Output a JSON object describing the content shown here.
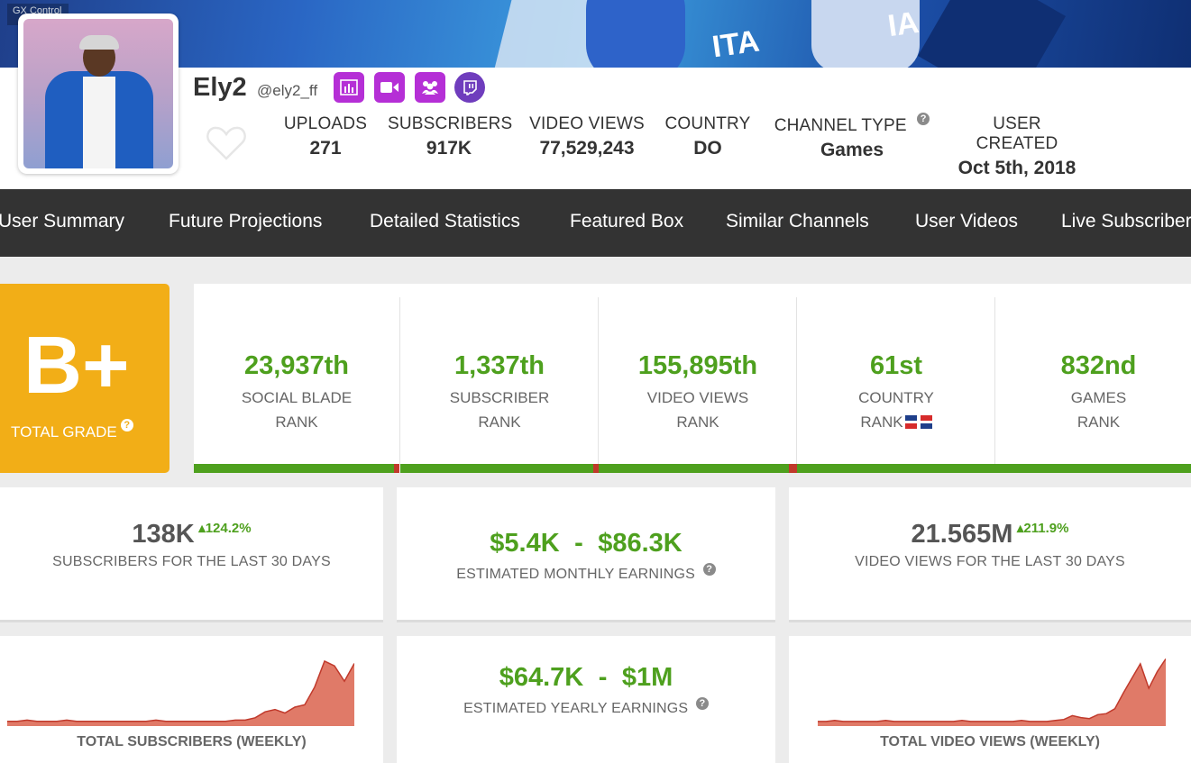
{
  "banner": {
    "control_label": "GX Control",
    "text_left": "ITA",
    "text_right": "IA"
  },
  "profile": {
    "name": "Ely2",
    "handle": "@ely2_ff",
    "icons": [
      "bar-chart-icon",
      "video-camera-icon",
      "group-icon",
      "twitch-icon"
    ],
    "icon_color": "#b52fd6",
    "twitch_color": "#6f3dbd"
  },
  "stats": [
    {
      "label": "UPLOADS",
      "value": "271"
    },
    {
      "label": "SUBSCRIBERS",
      "value": "917K"
    },
    {
      "label": "VIDEO VIEWS",
      "value": "77,529,243"
    },
    {
      "label": "COUNTRY",
      "value": "DO"
    },
    {
      "label": "CHANNEL TYPE",
      "value": "Games",
      "help": "?"
    },
    {
      "label": "USER CREATED",
      "value": "Oct 5th, 2018"
    }
  ],
  "nav": [
    "User Summary",
    "Future Projections",
    "Detailed Statistics",
    "Featured Box",
    "Similar Channels",
    "User Videos",
    "Live Subscriber"
  ],
  "grade": {
    "letter": "B+",
    "caption": "TOTAL GRADE",
    "help": "?",
    "color": "#f2ae17"
  },
  "ranks": [
    {
      "value": "23,937th",
      "line1": "SOCIAL BLADE",
      "line2": "RANK"
    },
    {
      "value": "1,337th",
      "line1": "SUBSCRIBER",
      "line2": "RANK"
    },
    {
      "value": "155,895th",
      "line1": "VIDEO VIEWS",
      "line2": "RANK"
    },
    {
      "value": "61st",
      "line1": "COUNTRY",
      "line2": "RANK"
    },
    {
      "value": "832nd",
      "line1": "GAMES",
      "line2": "RANK"
    }
  ],
  "summary": {
    "subs_30": {
      "value": "138K",
      "change": "124.2%",
      "label": "SUBSCRIBERS FOR THE LAST 30 DAYS"
    },
    "monthly": {
      "low": "$5.4K",
      "sep": "-",
      "high": "$86.3K",
      "label": "ESTIMATED MONTHLY EARNINGS",
      "help": "?"
    },
    "views_30": {
      "value": "21.565M",
      "change": "211.9%",
      "label": "VIDEO VIEWS FOR THE LAST 30 DAYS"
    },
    "yearly": {
      "low": "$64.7K",
      "sep": "-",
      "high": "$1M",
      "label": "ESTIMATED YEARLY EARNINGS",
      "help": "?"
    },
    "subs_chart_label": "TOTAL SUBSCRIBERS (WEEKLY)",
    "views_chart_label": "TOTAL VIDEO VIEWS (WEEKLY)"
  },
  "colors": {
    "green": "#4ea01e",
    "nav_bg": "#333333",
    "chart_fill": "#e07a68",
    "chart_line": "#c0392b"
  },
  "chart_data": [
    {
      "type": "area",
      "title": "TOTAL SUBSCRIBERS (WEEKLY)",
      "values": [
        1,
        1,
        2,
        1,
        1,
        1,
        2,
        1,
        1,
        1,
        1,
        1,
        1,
        1,
        1,
        2,
        1,
        1,
        1,
        1,
        1,
        1,
        1,
        2,
        2,
        4,
        9,
        11,
        8,
        13,
        15,
        30,
        52,
        48,
        35,
        50
      ],
      "ylim": [
        0,
        55
      ]
    },
    {
      "type": "area",
      "title": "TOTAL VIDEO VIEWS (WEEKLY)",
      "values": [
        1,
        1,
        2,
        1,
        1,
        1,
        1,
        1,
        2,
        1,
        1,
        1,
        1,
        1,
        1,
        1,
        1,
        2,
        1,
        1,
        1,
        1,
        1,
        1,
        2,
        1,
        1,
        1,
        2,
        3,
        7,
        5,
        4,
        8,
        9,
        14,
        30,
        45,
        60,
        35,
        52,
        65
      ],
      "ylim": [
        0,
        70
      ]
    }
  ]
}
